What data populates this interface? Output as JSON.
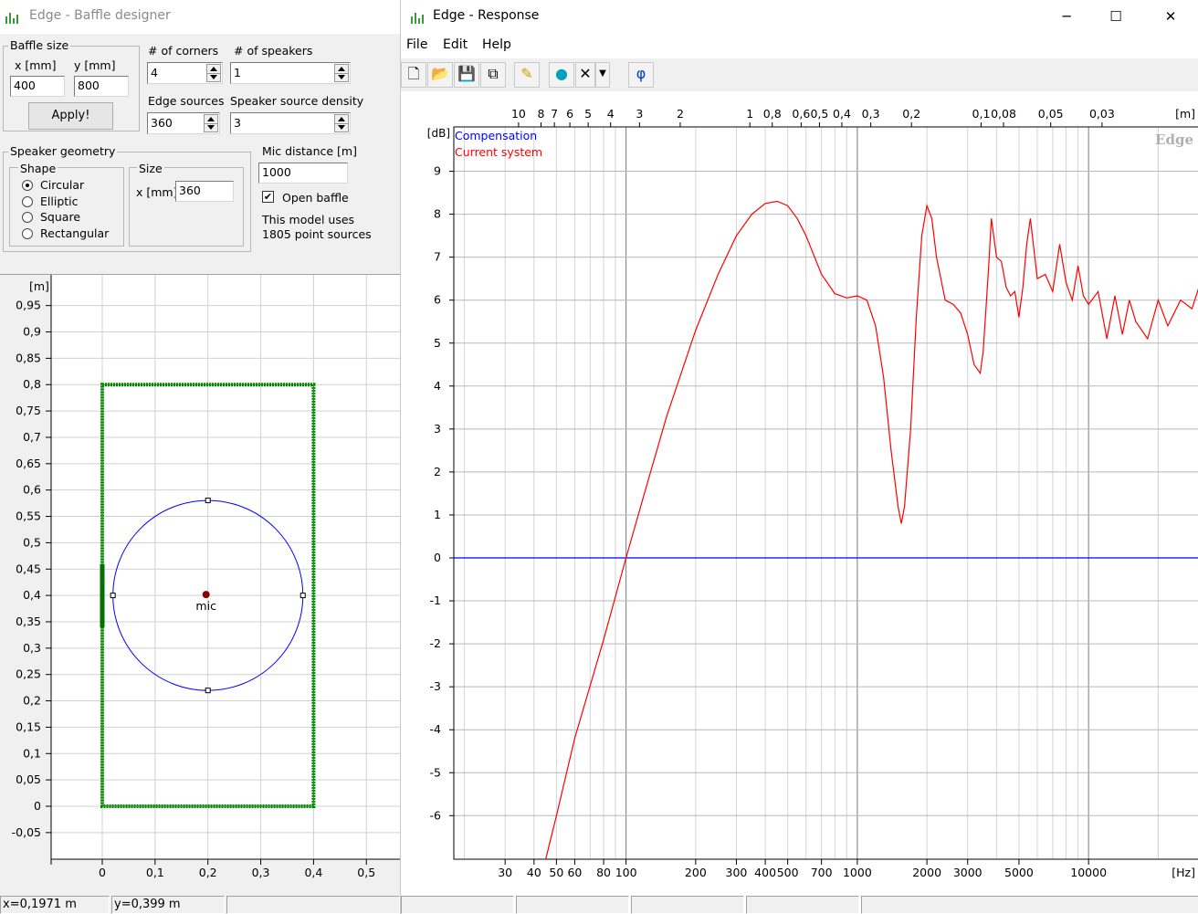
{
  "left": {
    "title": "Edge - Baffle designer",
    "baffle": {
      "group": "Baffle size",
      "x_label": "x [mm]",
      "y_label": "y [mm]",
      "x": "400",
      "y": "800",
      "apply": "Apply!"
    },
    "corners_label": "# of corners",
    "corners": "4",
    "speakers_label": "# of speakers",
    "speakers": "1",
    "edge_label": "Edge sources",
    "edge": "360",
    "density_label": "Speaker source density",
    "density": "3",
    "geom": {
      "group": "Speaker geometry",
      "shape_group": "Shape",
      "shapes": [
        "Circular",
        "Elliptic",
        "Square",
        "Rectangular"
      ],
      "selected": 0,
      "size_group": "Size",
      "size_label": "x [mm]",
      "size": "360"
    },
    "mic_label": "Mic distance [m]",
    "mic": "1000",
    "open_baffle": "Open baffle",
    "open_baffle_checked": true,
    "info1": "This model uses",
    "info2": "1805 point sources",
    "plot": {
      "unit": "[m]",
      "y_ticks": [
        "0,95",
        "0,9",
        "0,85",
        "0,8",
        "0,75",
        "0,7",
        "0,65",
        "0,6",
        "0,55",
        "0,5",
        "0,45",
        "0,4",
        "0,35",
        "0,3",
        "0,25",
        "0,2",
        "0,15",
        "0,1",
        "0,05",
        "0",
        "-0,05"
      ],
      "x_ticks": [
        "0",
        "0,1",
        "0,2",
        "0,3",
        "0,4",
        "0,5"
      ],
      "mic": "mic"
    },
    "status": [
      "x=0,1971 m",
      "y=0,399 m",
      ""
    ]
  },
  "right": {
    "title": "Edge - Response",
    "menu": [
      "File",
      "Edit",
      "Help"
    ],
    "watermark": "Edge",
    "legend": [
      {
        "label": "Compensation",
        "color": "#0000ff"
      },
      {
        "label": "Current system",
        "color": "#ff0000"
      }
    ],
    "y_unit": "[dB]",
    "x_unit": "[Hz]",
    "top_unit": "[m]",
    "y_ticks": [
      "9",
      "8",
      "7",
      "6",
      "5",
      "4",
      "3",
      "2",
      "1",
      "0",
      "-1",
      "-2",
      "-3",
      "-4",
      "-5",
      "-6"
    ],
    "x_ticks": [
      "30",
      "40",
      "50",
      "60",
      "80",
      "100",
      "200",
      "300",
      "400",
      "500",
      "700",
      "1000",
      "2000",
      "3000",
      "5000",
      "10000"
    ],
    "top_ticks": [
      "10",
      "8",
      "7",
      "6",
      "5",
      "4",
      "3",
      "2",
      "1",
      "0,8",
      "0,6",
      "0,5",
      "0,4",
      "0,3",
      "0,2",
      "0,1",
      "0,08",
      "0,05",
      "0,03"
    ],
    "status": [
      "",
      "",
      "",
      "",
      ""
    ]
  },
  "chart_data": {
    "type": "line",
    "xlabel": "[Hz]",
    "ylabel": "[dB]",
    "x_scale": "log",
    "xlim": [
      18,
      30000
    ],
    "ylim": [
      -7,
      10
    ],
    "grid": true,
    "series": [
      {
        "name": "Compensation",
        "color": "#0000ff",
        "x": [
          18,
          30000
        ],
        "y": [
          0,
          0
        ]
      },
      {
        "name": "Current system",
        "color": "#ff0000",
        "x": [
          45,
          50,
          60,
          80,
          100,
          120,
          150,
          200,
          250,
          300,
          350,
          400,
          450,
          500,
          550,
          600,
          700,
          800,
          900,
          1000,
          1100,
          1200,
          1300,
          1400,
          1500,
          1550,
          1600,
          1700,
          1800,
          1900,
          2000,
          2100,
          2200,
          2400,
          2600,
          2800,
          3000,
          3200,
          3400,
          3500,
          3600,
          3700,
          3800,
          4000,
          4200,
          4400,
          4600,
          4800,
          5000,
          5200,
          5400,
          5600,
          5800,
          6000,
          6500,
          7000,
          7500,
          8000,
          8500,
          9000,
          9500,
          10000,
          11000,
          12000,
          13000,
          14000,
          15000,
          16000,
          18000,
          20000,
          22000,
          25000,
          28000,
          30000
        ],
        "y": [
          -7.0,
          -6.0,
          -4.2,
          -1.9,
          0.0,
          1.5,
          3.3,
          5.3,
          6.6,
          7.5,
          8.0,
          8.25,
          8.3,
          8.2,
          7.9,
          7.5,
          6.6,
          6.15,
          6.05,
          6.1,
          6.0,
          5.4,
          4.2,
          2.5,
          1.2,
          0.8,
          1.2,
          3.0,
          5.6,
          7.5,
          8.2,
          7.9,
          7.0,
          6.0,
          5.9,
          5.7,
          5.2,
          4.5,
          4.3,
          4.8,
          5.8,
          6.8,
          7.9,
          7.0,
          6.9,
          6.3,
          6.1,
          6.2,
          5.6,
          6.3,
          7.3,
          7.9,
          7.2,
          6.5,
          6.6,
          6.2,
          7.3,
          6.4,
          6.0,
          6.8,
          6.1,
          5.9,
          6.2,
          5.1,
          6.1,
          5.2,
          6.0,
          5.5,
          5.1,
          6.0,
          5.4,
          6.0,
          5.8,
          6.3
        ]
      }
    ]
  }
}
